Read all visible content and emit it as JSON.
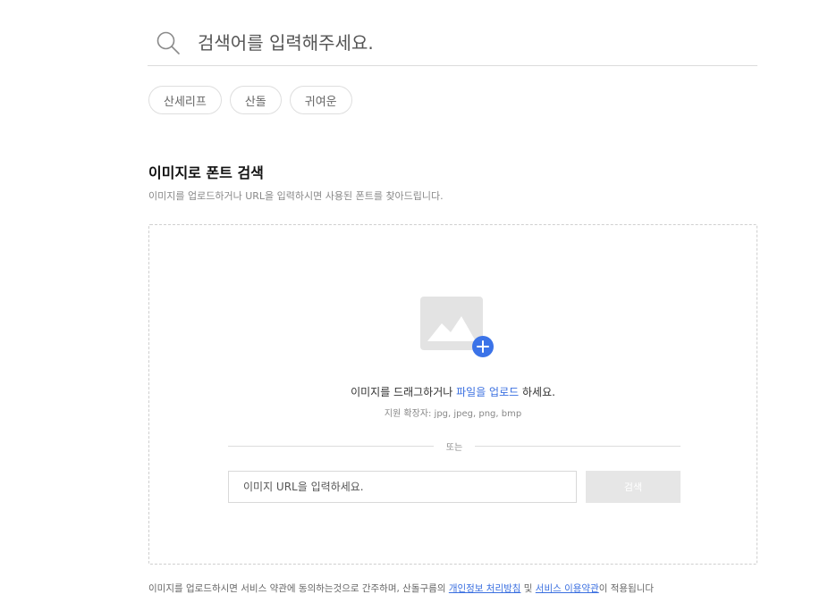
{
  "search": {
    "placeholder": "검색어를 입력해주세요."
  },
  "tags": [
    "산세리프",
    "산돌",
    "귀여운"
  ],
  "section": {
    "title": "이미지로 폰트 검색",
    "description": "이미지를 업로드하거나 URL을 입력하시면 사용된 폰트를 찾아드립니다."
  },
  "dropzone": {
    "drag_prefix": "이미지를 드래그하거나 ",
    "upload_link": "파일을 업로드",
    "drag_suffix": " 하세요.",
    "formats": "지원 확장자: jpg, jpeg, png, bmp",
    "divider_label": "또는",
    "url_placeholder": "이미지 URL을 입력하세요.",
    "search_button": "검색"
  },
  "footer": {
    "prefix": "이미지를 업로드하시면 서비스 약관에 동의하는것으로 간주하며, 산돌구름의 ",
    "privacy_link": "개인정보 처리방침",
    "middle": " 및 ",
    "terms_link": "서비스 이용약관",
    "suffix": "이 적용됩니다"
  },
  "colors": {
    "accent": "#3a6fe0",
    "plus_badge": "#3b73e8",
    "image_placeholder": "#e3e3e3"
  }
}
